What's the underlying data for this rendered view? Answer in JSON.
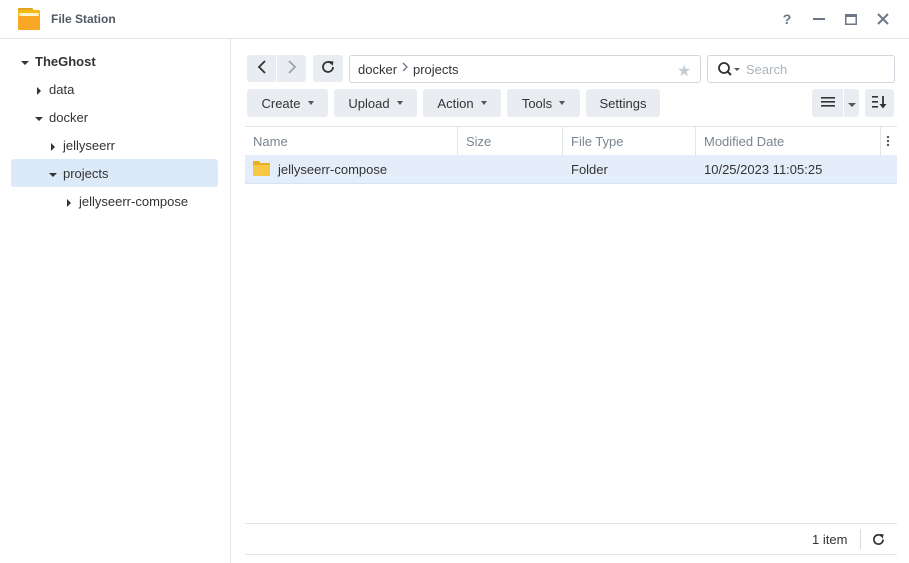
{
  "window": {
    "title": "File Station",
    "help_label": "?",
    "controls": [
      "help-icon",
      "minimize-icon",
      "maximize-icon",
      "close-icon"
    ]
  },
  "sidebar": {
    "items": [
      {
        "label": "TheGhost",
        "level": 0,
        "expanded": true,
        "bold": true
      },
      {
        "label": "data",
        "level": 1,
        "expanded": false
      },
      {
        "label": "docker",
        "level": 1,
        "expanded": true
      },
      {
        "label": "jellyseerr",
        "level": 2,
        "expanded": false
      },
      {
        "label": "projects",
        "level": 2,
        "expanded": true,
        "selected": true
      },
      {
        "label": "jellyseerr-compose",
        "level": 3,
        "expanded": false
      }
    ]
  },
  "navigation": {
    "back_icon": "chevron-left-icon",
    "forward_icon": "chevron-right-icon",
    "refresh_icon": "refresh-icon"
  },
  "path": {
    "segments": [
      "docker",
      "projects"
    ],
    "favorite_icon": "star-icon"
  },
  "search": {
    "placeholder": "Search",
    "value": ""
  },
  "toolbar": {
    "create_label": "Create",
    "upload_label": "Upload",
    "action_label": "Action",
    "tools_label": "Tools",
    "settings_label": "Settings",
    "view_icon": "list-view-icon",
    "sort_icon": "sort-icon"
  },
  "file_list": {
    "columns": [
      "Name",
      "Size",
      "File Type",
      "Modified Date"
    ],
    "rows": [
      {
        "name": "jellyseerr-compose",
        "size": "",
        "type": "Folder",
        "modified": "10/25/2023 11:05:25",
        "icon": "folder-icon"
      }
    ]
  },
  "footer": {
    "item_count": "1 item"
  },
  "colors": {
    "selection": "#dbe9f8",
    "row_selected": "#e4eefa",
    "button_bg": "#e9edf1",
    "folder": "#f7c843"
  }
}
